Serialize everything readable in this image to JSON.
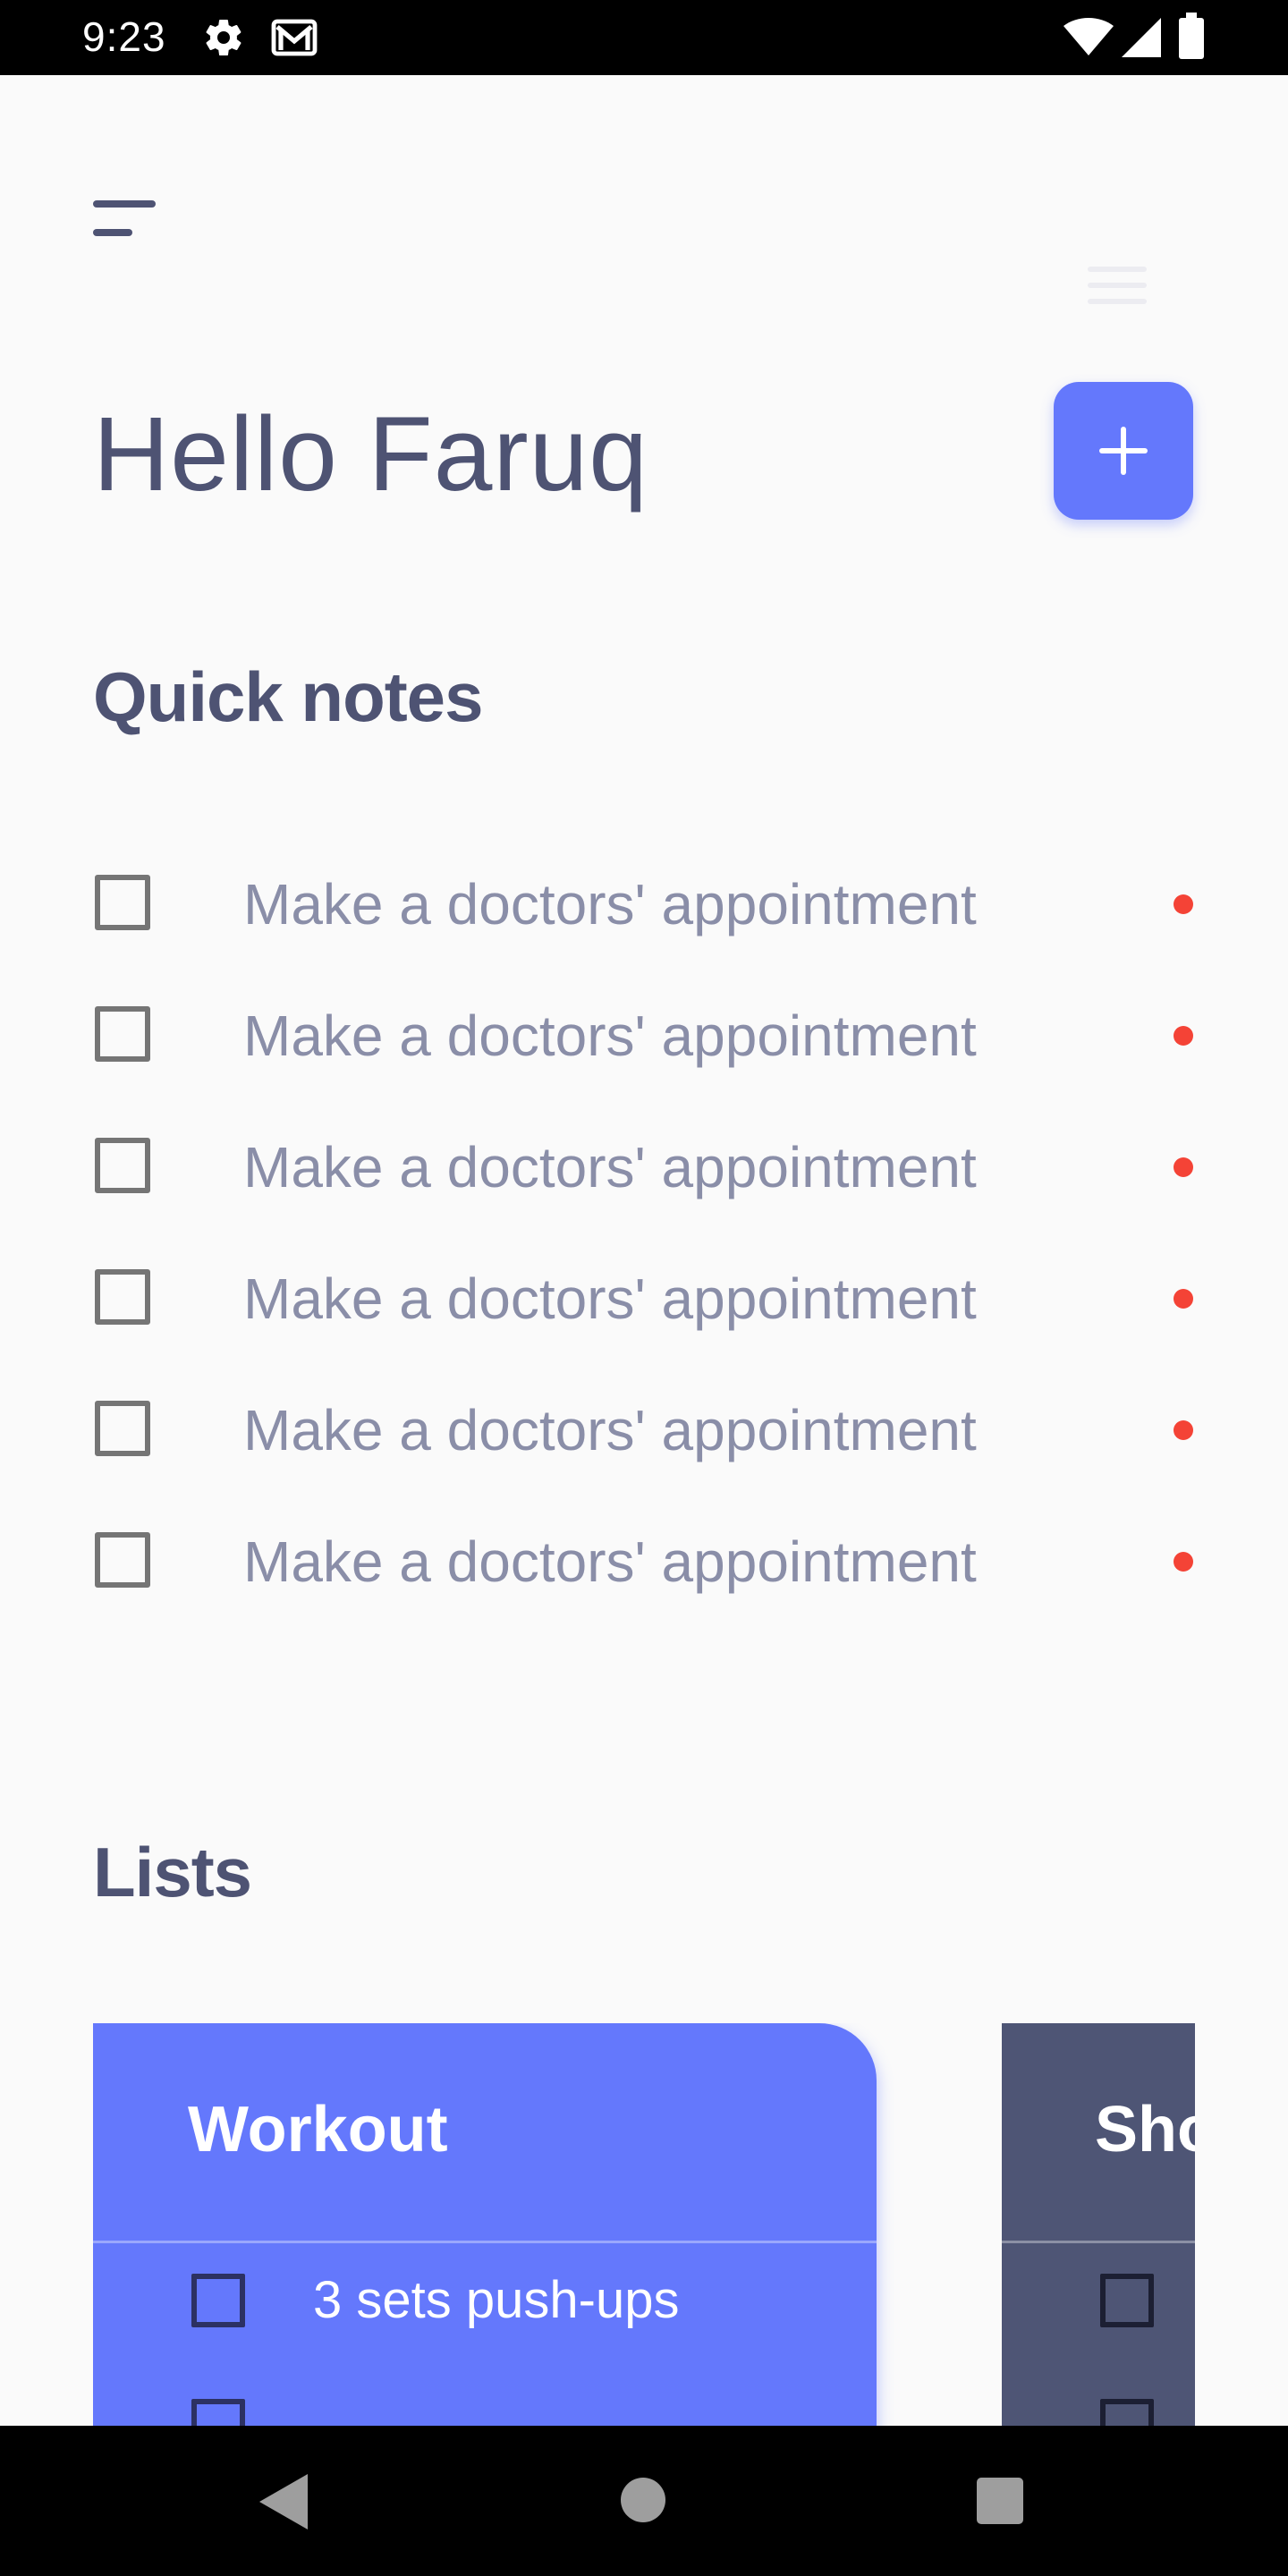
{
  "status_bar": {
    "time": "9:23",
    "icons": [
      "gear-icon",
      "gmail-icon",
      "wifi-icon",
      "signal-icon",
      "battery-icon"
    ]
  },
  "header": {
    "greeting": "Hello Faruq",
    "add_icon": "plus-icon"
  },
  "quick_notes": {
    "title": "Quick notes",
    "items": [
      {
        "text": "Make a doctors' appointment",
        "checked": false
      },
      {
        "text": "Make a doctors' appointment",
        "checked": false
      },
      {
        "text": "Make a doctors' appointment",
        "checked": false
      },
      {
        "text": "Make a doctors' appointment",
        "checked": false
      },
      {
        "text": "Make a doctors' appointment",
        "checked": false
      },
      {
        "text": "Make a doctors' appointment",
        "checked": false
      }
    ]
  },
  "lists": {
    "title": "Lists",
    "cards": [
      {
        "title": "Workout",
        "items": [
          {
            "text": "3 sets push-ups",
            "checked": false
          }
        ]
      },
      {
        "title": "Shopping",
        "items": []
      }
    ]
  },
  "colors": {
    "accent": "#6478fc",
    "text_dark": "#4e5373",
    "text_muted": "#8a8ea8",
    "dot": "#f44336",
    "card_dark": "#4e5575"
  },
  "nav_bar": {
    "icons": [
      "back-icon",
      "home-icon",
      "recents-icon"
    ]
  }
}
